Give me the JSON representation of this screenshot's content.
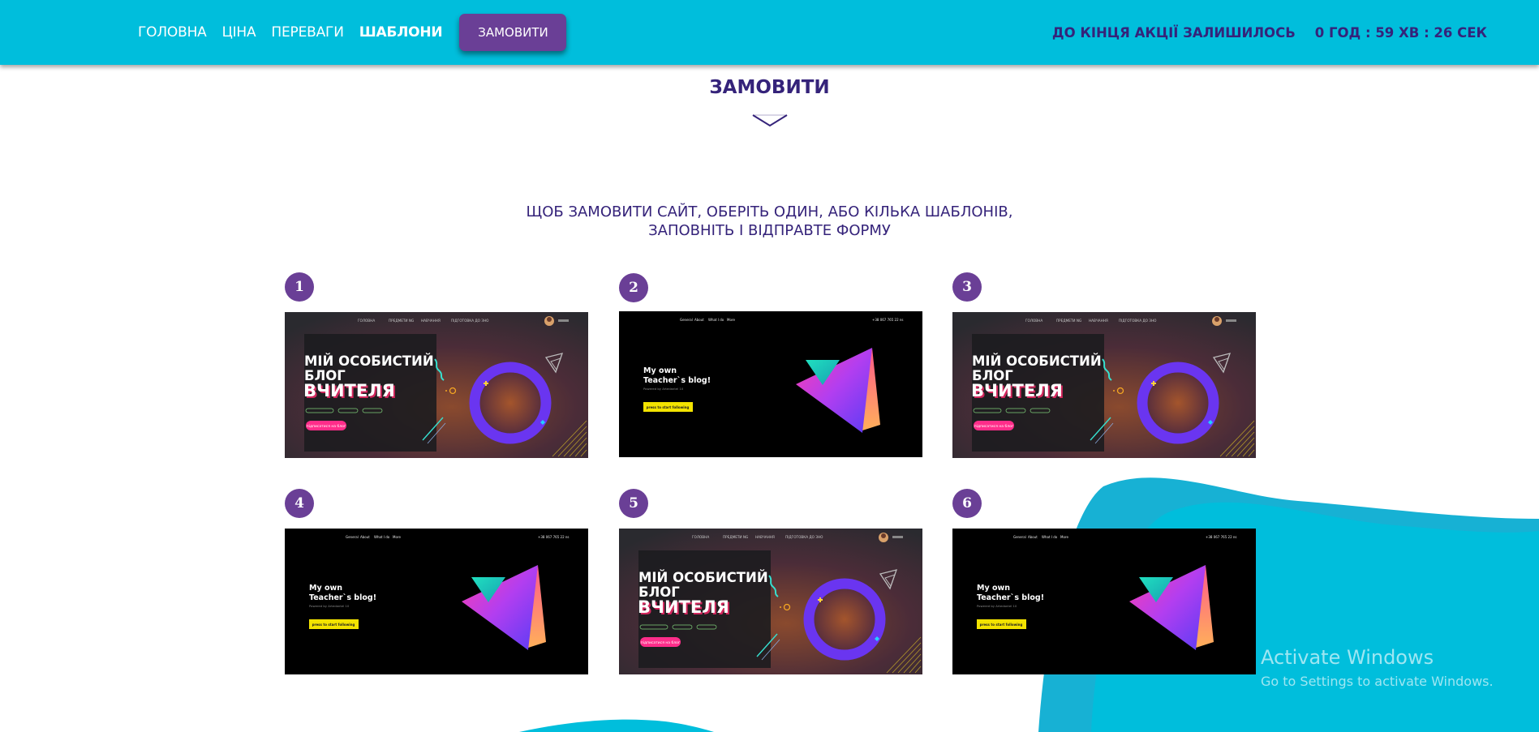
{
  "nav": {
    "links": [
      "ГОЛОВНА",
      "ЦІНА",
      "ПЕРЕВАГИ",
      "ШАБЛОНИ"
    ],
    "order_button": "ЗАМОВИТИ",
    "timer_label": "ДО КІНЦЯ АКЦІЇ ЗАЛИШИЛОСЬ",
    "timer_value": "0 ГОД : 59 ХВ : 26 СЕК"
  },
  "section": {
    "title": "ЗАМОВИТИ",
    "subtitle_line1": "ЩОБ ЗАМОВИТИ САЙТ, ОБЕРІТЬ ОДИН, АБО КІЛЬКА ШАБЛОНІВ,",
    "subtitle_line2": "ЗАПОВНІТЬ І ВІДПРАВТЕ ФОРМУ"
  },
  "templates": [
    {
      "number": "1",
      "style": "ua"
    },
    {
      "number": "2",
      "style": "en"
    },
    {
      "number": "3",
      "style": "ua"
    },
    {
      "number": "4",
      "style": "en"
    },
    {
      "number": "5",
      "style": "ua"
    },
    {
      "number": "6",
      "style": "en"
    }
  ],
  "thumb_ua": {
    "nav": [
      "ГОЛОВНА",
      "ПРЕДМЕТИ NG",
      "НАВЧАННЯ",
      "ПІДГОТОВКА ДО ЗНО"
    ],
    "title1": "МІЙ ОСОБИСТИЙ",
    "title2": "БЛОГ",
    "title3": "ВЧИТЕЛЯ",
    "button": "підписатися на блог"
  },
  "thumb_en": {
    "nav": [
      "General",
      "About",
      "What I do",
      "More"
    ],
    "phone": "+38 067 765 22 ns",
    "title1": "My own",
    "title2": "Teacher`s blog!",
    "powered": "Powered by Artedantel 10",
    "button": "press to start following"
  },
  "watermark": {
    "line1": "Activate Windows",
    "line2": "Go to Settings to activate Windows."
  },
  "colors": {
    "nav_bg": "#00bedc",
    "accent": "#6a3f96",
    "text_dark": "#35237a",
    "wave": "#00bedc"
  }
}
